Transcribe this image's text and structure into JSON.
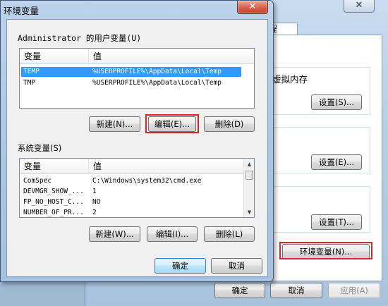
{
  "background_window": {
    "close_glyph": "✕",
    "tab_label": "程",
    "text_line": "。",
    "group_title": "虚拟内存",
    "settings_buttons": [
      "设置(S)...",
      "设置(E)...",
      "设置(T)..."
    ],
    "env_var_button": "环境变量(N)...",
    "bottom_buttons": {
      "ok": "确定",
      "cancel": "取消",
      "apply": "应用(A)"
    }
  },
  "dialog": {
    "title": "环境变量",
    "close_glyph": "✕",
    "user_vars": {
      "label": "Administrator 的用户变量(U)",
      "columns": [
        "变量",
        "值"
      ],
      "rows": [
        {
          "name": "TEMP",
          "value": "%USERPROFILE%\\AppData\\Local\\Temp",
          "selected": true
        },
        {
          "name": "TMP",
          "value": "%USERPROFILE%\\AppData\\Local\\Temp",
          "selected": false
        }
      ],
      "buttons": {
        "new": "新建(N)...",
        "edit": "编辑(E)...",
        "delete": "删除(D)"
      }
    },
    "system_vars": {
      "label": "系统变量(S)",
      "columns": [
        "变量",
        "值"
      ],
      "rows": [
        {
          "name": "ComSpec",
          "value": "C:\\Windows\\system32\\cmd.exe"
        },
        {
          "name": "DEVMGR_SHOW_...",
          "value": "1"
        },
        {
          "name": "FP_NO_HOST_C...",
          "value": "NO"
        },
        {
          "name": "NUMBER_OF_PR...",
          "value": "2"
        }
      ],
      "buttons": {
        "new": "新建(W)...",
        "edit": "编辑(I)...",
        "delete": "删除(L)"
      }
    },
    "ok_button": "确定",
    "cancel_button": "取消"
  },
  "colors": {
    "highlight_border": "#d9262a",
    "selection": "#3399ff"
  }
}
